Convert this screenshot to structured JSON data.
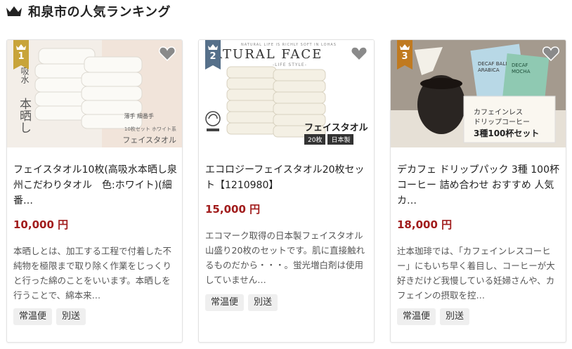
{
  "header": {
    "title": "和泉市の人気ランキング",
    "icon": "crown-icon"
  },
  "colors": {
    "rank1": "#c8a43a",
    "rank2": "#56708a",
    "rank3": "#c07a20",
    "price": "#a11c1c",
    "tag_bg": "#efefef"
  },
  "cards": [
    {
      "rank": "1",
      "image_text": {
        "vertical_a": "吸水",
        "vertical_b": "本晒し",
        "corner_small": "薄手 細番手",
        "corner_sub": "10枚セット ホワイト系",
        "corner_label": "フェイスタオル"
      },
      "title": "フェイスタオル10枚(高吸水本晒し泉州こだわりタオル　色:ホワイト)(細番…",
      "price": "10,000 円",
      "desc": "本晒しとは、加工する工程で付着した不純物を極限まで取り除く作業をじっくりと行った綿のことをいいます。本晒しを行うことで、綿本来…",
      "tags": [
        "常温便",
        "別送"
      ]
    },
    {
      "rank": "2",
      "image_text": {
        "brand_small": "NATURAL LIFE IS RICHLY SOFT IN LOHAS",
        "brand": "ATURAL FACE",
        "brand_sub": "-LIFE STYLE-",
        "label": "フェイスタオル",
        "badge_count": "20枚",
        "badge_made": "日本製"
      },
      "title": "エコロジーフェイスタオル20枚セット【1210980】",
      "price": "15,000 円",
      "desc": "エコマーク取得の日本製フェイスタオル山盛り20枚のセットです。肌に直接触れるものだから・・・。蛍光増白剤は使用していません…",
      "tags": [
        "常温便",
        "別送"
      ]
    },
    {
      "rank": "3",
      "image_text": {
        "pkg_a": "DECAF BALI ARABICA",
        "pkg_b": "DECAF MOCHA",
        "label_1": "カフェインレス",
        "label_2": "ドリップコーヒー",
        "label_3": "3種100杯セット"
      },
      "title": "デカフェ ドリップパック 3種 100杯 コーヒー 詰め合わせ おすすめ 人気 カ…",
      "price": "18,000 円",
      "desc": "辻本珈琲では、「カフェインレスコーヒー」にもいち早く着目し、コーヒーが大好きだけど我慢している妊婦さんや、カフェインの摂取を控…",
      "tags": [
        "常温便",
        "別送"
      ]
    }
  ]
}
